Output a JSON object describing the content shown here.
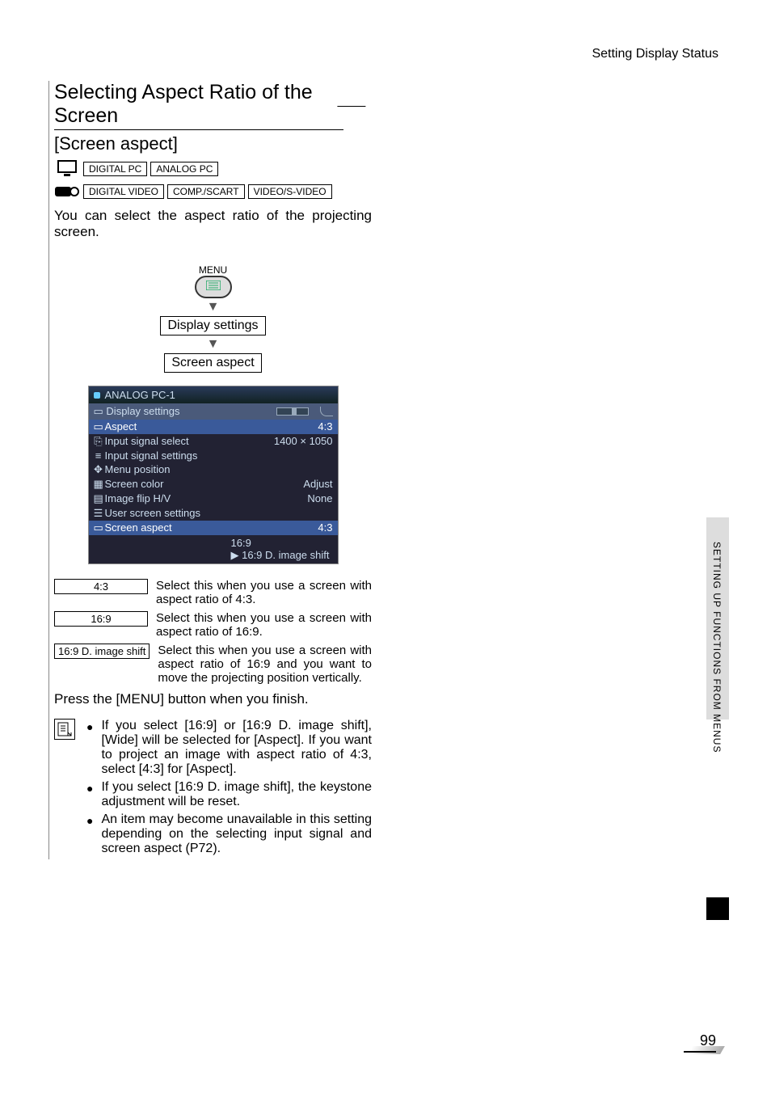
{
  "header": {
    "breadcrumb": "Setting Display Status"
  },
  "title": "Selecting Aspect Ratio of the Screen",
  "subtitle": "[Screen aspect]",
  "modes": {
    "pc": [
      "DIGITAL PC",
      "ANALOG PC"
    ],
    "video": [
      "DIGITAL VIDEO",
      "COMP./SCART",
      "VIDEO/S-VIDEO"
    ]
  },
  "description": "You can select the aspect ratio of the projecting screen.",
  "flow": {
    "menu_label": "MENU",
    "step1": "Display settings",
    "step2": "Screen aspect"
  },
  "osd": {
    "signal": "ANALOG PC-1",
    "section": "Display settings",
    "rows": [
      {
        "label": "Aspect",
        "value": "4:3",
        "icon": "▭",
        "sel": true
      },
      {
        "label": "Input signal select",
        "value": "1400 × 1050",
        "icon": "⎘"
      },
      {
        "label": "Input signal settings",
        "value": "",
        "icon": "≡"
      },
      {
        "label": "Menu position",
        "value": "",
        "icon": "✥"
      },
      {
        "label": "Screen color",
        "value": "Adjust",
        "icon": "▦"
      },
      {
        "label": "Image flip H/V",
        "value": "None",
        "icon": "▤"
      },
      {
        "label": "User screen settings",
        "value": "",
        "icon": "☰"
      },
      {
        "label": "Screen aspect",
        "value": "4:3",
        "icon": "▭",
        "sel": true
      }
    ],
    "options": [
      "16:9",
      "16:9 D. image shift"
    ]
  },
  "option_table": [
    {
      "label": "4:3",
      "desc": "Select this when you use a screen with aspect ratio of 4:3."
    },
    {
      "label": "16:9",
      "desc": "Select this when you use a screen with aspect ratio of 16:9."
    },
    {
      "label": "16:9 D. image shift",
      "desc": "Select this when you use a screen with aspect ratio of 16:9 and you want to move the projecting position vertically."
    }
  ],
  "press_line": "Press the [MENU] button when you finish.",
  "notes": [
    "If you select [16:9] or [16:9 D. image shift], [Wide] will be selected for [Aspect]. If you want to project an image with aspect ratio of 4:3, select [4:3] for [Aspect].",
    "If you select [16:9 D. image shift], the keystone adjustment will be reset.",
    "An item may become unavailable in this setting depending on the selecting input signal and screen aspect (P72)."
  ],
  "side_text": "SETTING UP FUNCTIONS FROM MENUS",
  "page_number": "99"
}
